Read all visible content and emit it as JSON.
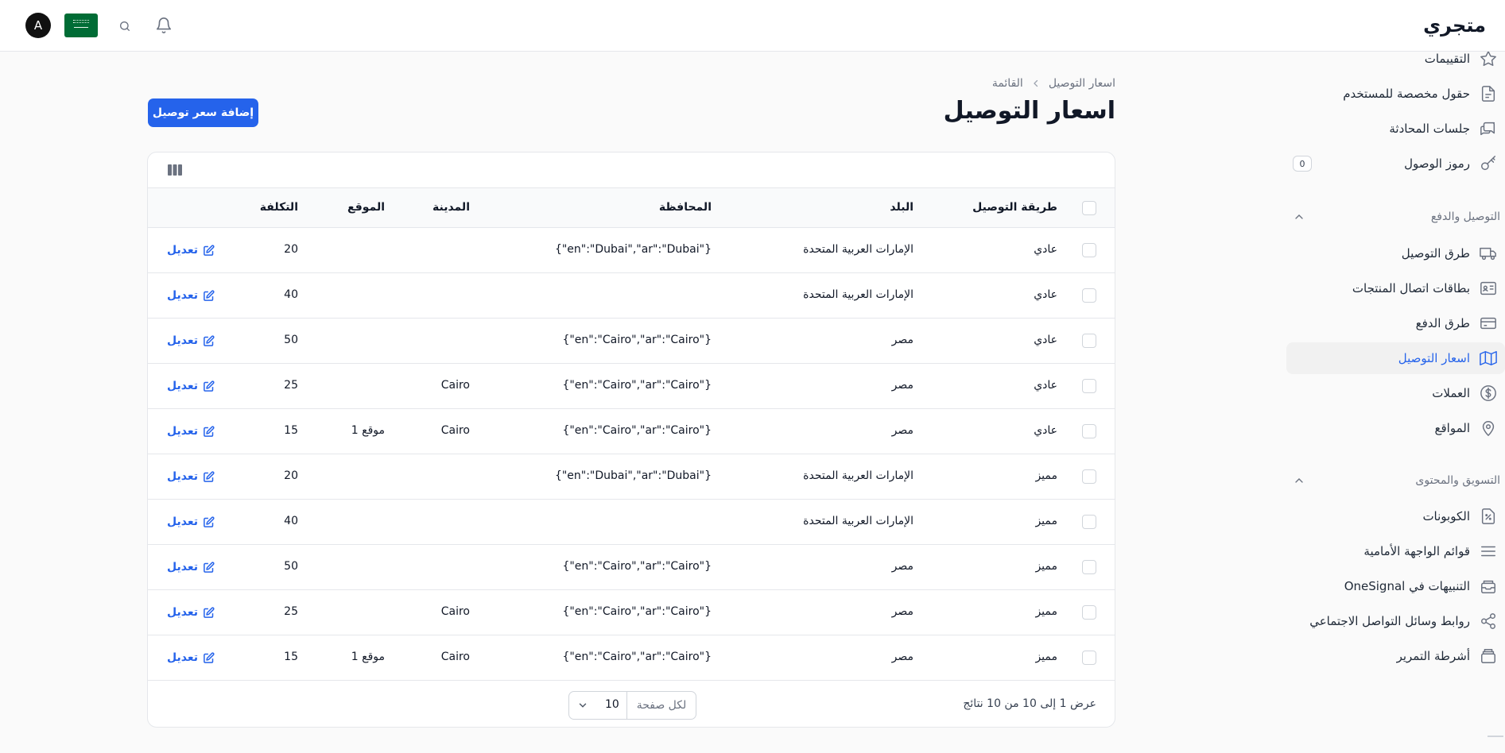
{
  "app": {
    "brand": "متجري",
    "user_initial": "A"
  },
  "colors": {
    "accent": "#2563eb",
    "flag": "#006c35"
  },
  "sidebar": {
    "items": [
      {
        "label": "التقييمات",
        "icon": "star-icon",
        "active": false
      },
      {
        "label": "حقول مخصصة للمستخدم",
        "icon": "document-icon",
        "active": false
      },
      {
        "label": "جلسات المحادثة",
        "icon": "chat-icon",
        "active": false
      },
      {
        "label": "رموز الوصول",
        "icon": "key-icon",
        "badge": "0",
        "active": false
      },
      {
        "label": "طرق التوصيل",
        "icon": "truck-icon",
        "active": false
      },
      {
        "label": "بطاقات اتصال المنتجات",
        "icon": "id-card-icon",
        "active": false
      },
      {
        "label": "طرق الدفع",
        "icon": "credit-card-icon",
        "active": false
      },
      {
        "label": "اسعار التوصيل",
        "icon": "map-icon",
        "active": true
      },
      {
        "label": "العملات",
        "icon": "dollar-icon",
        "active": false
      },
      {
        "label": "المواقع",
        "icon": "map-pin-icon",
        "active": false
      },
      {
        "label": "الكوبونات",
        "icon": "coupon-icon",
        "active": false
      },
      {
        "label": "قوائم الواجهة الأمامية",
        "icon": "menu-icon",
        "active": false
      },
      {
        "label": "التنبيهات في OneSignal",
        "icon": "inbox-icon",
        "active": false
      },
      {
        "label": "روابط وسائل التواصل الاجتماعي",
        "icon": "share-icon",
        "active": false
      },
      {
        "label": "أشرطة التمرير",
        "icon": "slider-stack-icon",
        "active": false
      }
    ],
    "groups": [
      {
        "title": "التوصيل والدفع"
      },
      {
        "title": "التسويق والمحتوى"
      }
    ]
  },
  "breadcrumb": {
    "first": "اسعار التوصيل",
    "second": "القائمة"
  },
  "page": {
    "title": "اسعار التوصيل",
    "add_button": "إضافة سعر توصيل"
  },
  "table": {
    "columns": {
      "method": "طريقة التوصيل",
      "country": "البلد",
      "governorate": "المحافظة",
      "city": "المدينة",
      "location": "الموقع",
      "cost": "التكلفة"
    },
    "edit_label": "تعديل",
    "rows": [
      {
        "method": "عادي",
        "country": "الإمارات العربية المتحدة",
        "governorate": "{\"en\":\"Dubai\",\"ar\":\"Dubai\"}",
        "city": "",
        "location": "",
        "cost": "20"
      },
      {
        "method": "عادي",
        "country": "الإمارات العربية المتحدة",
        "governorate": "",
        "city": "",
        "location": "",
        "cost": "40"
      },
      {
        "method": "عادي",
        "country": "مصر",
        "governorate": "{\"en\":\"Cairo\",\"ar\":\"Cairo\"}",
        "city": "",
        "location": "",
        "cost": "50"
      },
      {
        "method": "عادي",
        "country": "مصر",
        "governorate": "{\"en\":\"Cairo\",\"ar\":\"Cairo\"}",
        "city": "Cairo",
        "location": "",
        "cost": "25"
      },
      {
        "method": "عادي",
        "country": "مصر",
        "governorate": "{\"en\":\"Cairo\",\"ar\":\"Cairo\"}",
        "city": "Cairo",
        "location": "موقع 1",
        "cost": "15"
      },
      {
        "method": "مميز",
        "country": "الإمارات العربية المتحدة",
        "governorate": "{\"en\":\"Dubai\",\"ar\":\"Dubai\"}",
        "city": "",
        "location": "",
        "cost": "20"
      },
      {
        "method": "مميز",
        "country": "الإمارات العربية المتحدة",
        "governorate": "",
        "city": "",
        "location": "",
        "cost": "40"
      },
      {
        "method": "مميز",
        "country": "مصر",
        "governorate": "{\"en\":\"Cairo\",\"ar\":\"Cairo\"}",
        "city": "",
        "location": "",
        "cost": "50"
      },
      {
        "method": "مميز",
        "country": "مصر",
        "governorate": "{\"en\":\"Cairo\",\"ar\":\"Cairo\"}",
        "city": "Cairo",
        "location": "",
        "cost": "25"
      },
      {
        "method": "مميز",
        "country": "مصر",
        "governorate": "{\"en\":\"Cairo\",\"ar\":\"Cairo\"}",
        "city": "Cairo",
        "location": "موقع 1",
        "cost": "15"
      }
    ]
  },
  "pagination": {
    "results_text": "عرض 1 إلى 10 من 10 نتائج",
    "per_page_label": "لكل صفحة",
    "per_page_value": "10"
  }
}
